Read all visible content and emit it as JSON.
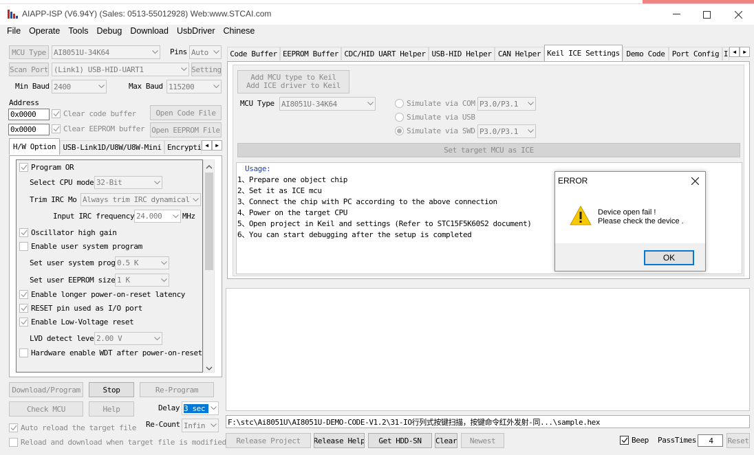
{
  "window": {
    "title": "AIAPP-ISP (V6.94Y) (Sales: 0513-55012928) Web:www.STCAI.com",
    "app_icon": "satellite-dish-icon",
    "controls": [
      "minimize-icon",
      "maximize-icon",
      "close-icon"
    ]
  },
  "menu": [
    "File",
    "Operate",
    "Tools",
    "Debug",
    "Download",
    "UsbDriver",
    "Chinese"
  ],
  "left": {
    "mcu_type_label": "MCU Type",
    "mcu_type_value": "AI8051U-34K64",
    "pins_label": "Pins",
    "pins_value": "Auto",
    "scan_port_label": "Scan Port",
    "scan_port_value": "(Link1) USB-HID-UART1",
    "setting_label": "Setting",
    "min_baud_label": "Min Baud",
    "min_baud_value": "2400",
    "max_baud_label": "Max Baud",
    "max_baud_value": "115200",
    "address_label": "Address",
    "code_addr": "0x0000",
    "clear_code": "Clear code buffer",
    "open_code": "Open Code File",
    "eeprom_addr": "0x0000",
    "clear_eeprom": "Clear EEPROM buffer",
    "open_eeprom": "Open EEPROM File",
    "tabs": [
      "H/W Option",
      "USB-Link1D/U8W/U8W-Mini",
      "Encrypti"
    ],
    "options": {
      "program_or": "Program OR",
      "cpu_mode_label": "Select CPU mode",
      "cpu_mode_value": "32-Bit",
      "trim_label": "Trim IRC Mo",
      "trim_value": "Always trim IRC dynamicall",
      "irc_freq_label": "Input IRC frequency",
      "irc_freq_value": "24.000",
      "irc_unit": "MHz",
      "osc_gain": "Oscillator high gain",
      "user_prog": "Enable user system program",
      "user_prog_size_label": "Set user system prog",
      "user_prog_size_value": "0.5 K",
      "eeprom_size_label": "Set user EEPROM size",
      "eeprom_size_value": "1  K",
      "longer_reset": "Enable longer power-on-reset latency",
      "reset_io": "RESET pin used as I/O port",
      "low_voltage": "Enable Low-Voltage reset",
      "lvd_label": "LVD detect leve",
      "lvd_value": "2.00 V",
      "hw_wdt": "Hardware enable WDT after power-on-reset"
    },
    "download_program": "Download/Program",
    "stop": "Stop",
    "re_program": "Re-Program",
    "check_mcu": "Check MCU",
    "help": "Help",
    "delay_label": "Delay",
    "delay_value": "3 sec",
    "recount_label": "Re-Count",
    "recount_value": "Infin",
    "auto_reload": "Auto reload the target file",
    "reload_download": "Reload and download when target file is modified"
  },
  "right": {
    "tabs": [
      "Code Buffer",
      "EEPROM Buffer",
      "CDC/HID UART Helper",
      "USB-HID Helper",
      "CAN Helper",
      "Keil ICE Settings",
      "Demo Code",
      "Port Config",
      "I"
    ],
    "active_tab": "Keil ICE Settings",
    "add_mcu_line1": "Add MCU type to Keil",
    "add_mcu_line2": "Add ICE driver to Keil",
    "mcu_type_label": "MCU Type",
    "mcu_type_value": "AI8051U-34K64",
    "sim_com": "Simulate via COM",
    "sim_com_port": "P3.0/P3.1",
    "sim_usb": "Simulate via USB",
    "sim_swd": "Simulate via SWD",
    "sim_swd_port": "P3.0/P3.1",
    "set_target": "Set target MCU as ICE",
    "usage_title": "Usage:",
    "usage": [
      "1、Prepare one object chip",
      "2、Set it as ICE mcu",
      "3、Connect the chip with PC according to the above connection",
      "4、Power on the target CPU",
      "5、Open project in Keil and settings (Refer to STC15F5K60S2 document)",
      "6、You can start debugging after the setup is completed"
    ],
    "file_path": "F:\\stc\\Ai8051U\\AI8051U-DEMO-CODE-V1.2\\31-IO行列式按键扫描，按键命令红外发射-同...\\sample.hex",
    "release_project": "Release Project",
    "release_help": "Release Help",
    "get_hdd_sn": "Get HDD-SN",
    "clear": "Clear",
    "newest": "Newest",
    "beep": "Beep",
    "pass_times_label": "PassTimes",
    "pass_times_value": "4",
    "reset": "Reset"
  },
  "dialog": {
    "title": "ERROR",
    "icon": "warning-icon",
    "message_line1": "Device open fail !",
    "message_line2": "Please check the device .",
    "ok": "OK"
  },
  "colors": {
    "dialog_warning": "#f7c900",
    "selection": "#0078d7",
    "tab_active_bg": "#ffffff"
  }
}
